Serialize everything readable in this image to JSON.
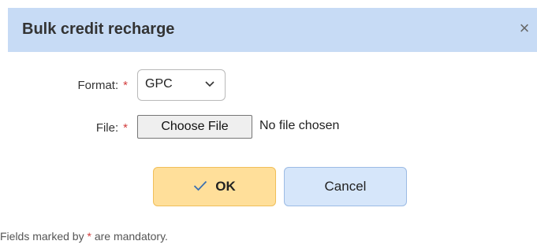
{
  "dialog": {
    "title": "Bulk credit recharge",
    "close_symbol": "×"
  },
  "form": {
    "format_label": "Format:",
    "required_marker": "*",
    "format_value": "GPC",
    "file_label": "File:",
    "file_button_label": "Choose File",
    "file_status": "No file chosen"
  },
  "actions": {
    "ok_label": "OK",
    "ok_icon": "check-icon",
    "cancel_label": "Cancel"
  },
  "footer": {
    "note_prefix": "Fields marked by",
    "note_marker": "*",
    "note_suffix": "are mandatory."
  },
  "colors": {
    "titlebar": "#c7dbf5",
    "ok_button": "#ffdf9a",
    "cancel_button": "#d6e6fa",
    "required": "#d23c3c"
  }
}
